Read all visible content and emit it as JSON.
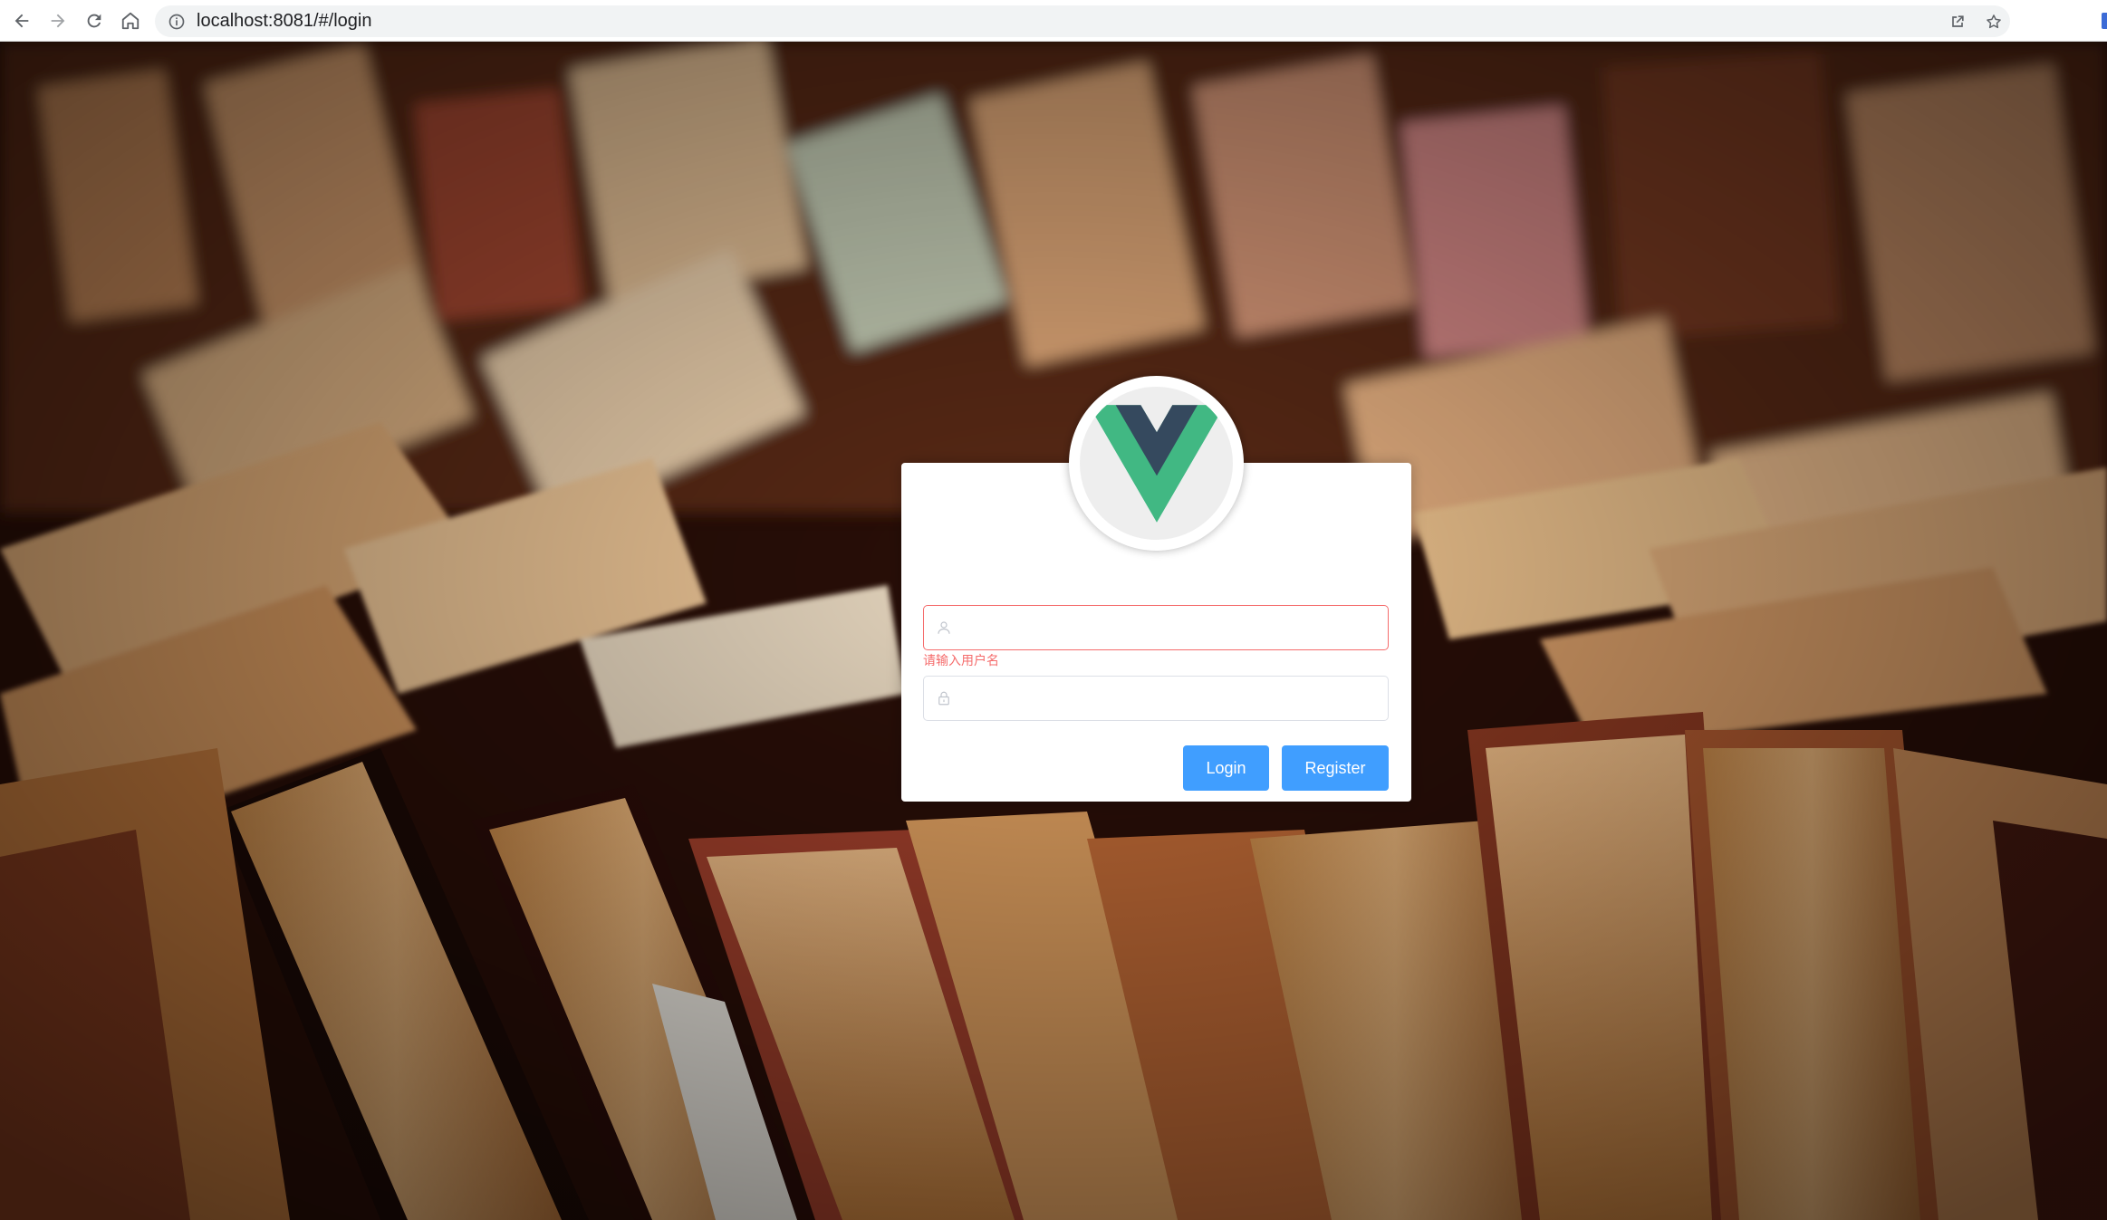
{
  "browser": {
    "url": "localhost:8081/#/login",
    "icons": [
      "back-arrow-icon",
      "forward-arrow-icon",
      "reload-icon",
      "home-icon",
      "site-info-icon",
      "share-icon",
      "bookmark-star-icon"
    ]
  },
  "login": {
    "logo": "vue-logo",
    "username": {
      "value": "",
      "placeholder": "",
      "icon": "user-icon",
      "error": "请输入用户名"
    },
    "password": {
      "value": "",
      "placeholder": "",
      "icon": "lock-icon"
    },
    "login_label": "Login",
    "register_label": "Register"
  },
  "colors": {
    "primary": "#409eff",
    "error": "#f56c6c",
    "vue_green": "#41b883",
    "vue_dark": "#35495e"
  }
}
